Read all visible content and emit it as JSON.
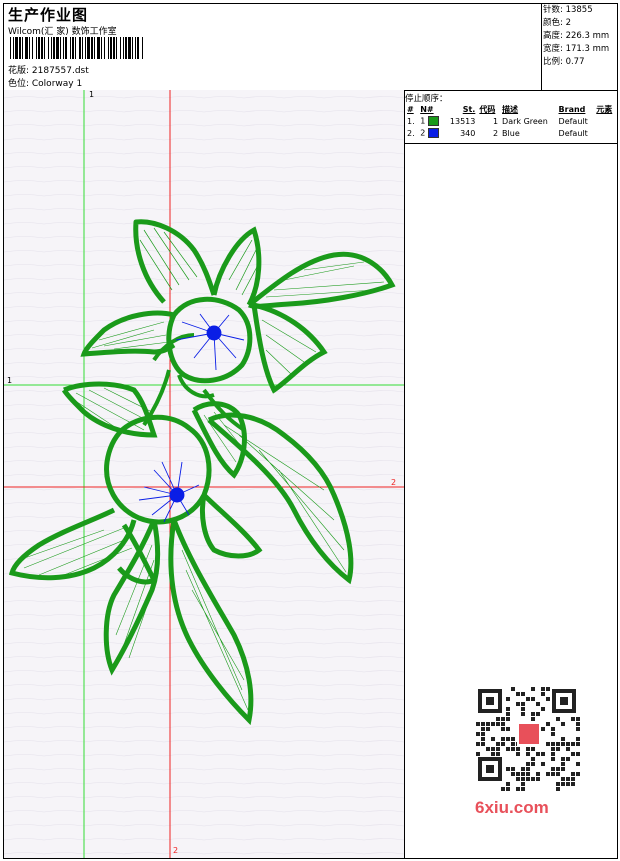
{
  "header": {
    "title": "生产作业图",
    "company": "Wilcom(汇 家) 数饰工作室",
    "file": "花版: 2187557.dst",
    "colorway": "色位:  Colorway 1"
  },
  "specs": {
    "stitches": "针数: 13855",
    "colors": "颜色: 2",
    "height": "高度: 226.3 mm",
    "width": "宽度: 171.3 mm",
    "scale": "比例: 0.77"
  },
  "thread_panel": {
    "title": "停止顺序：",
    "columns": [
      "#",
      "N#",
      "St.",
      "代码",
      "描述",
      "Brand",
      "元素"
    ],
    "rows": [
      {
        "idx": "1.",
        "n": "1",
        "color": "#1a9a1a",
        "stitches": "13513",
        "code": "1",
        "desc": "Dark Green",
        "brand": "Default"
      },
      {
        "idx": "2.",
        "n": "2",
        "color": "#0a1ee6",
        "stitches": "340",
        "code": "2",
        "desc": "Blue",
        "brand": "Default"
      }
    ]
  },
  "guides": {
    "green_label_top": "1",
    "green_label_left": "1",
    "red_label_right": "2",
    "red_label_bottom": "2"
  },
  "watermark": {
    "site": "6xiu.com"
  },
  "colors": {
    "green": "#1a9a1a",
    "blue": "#0a1ee6",
    "guide_green": "#33dd33",
    "guide_red": "#ee2222"
  }
}
